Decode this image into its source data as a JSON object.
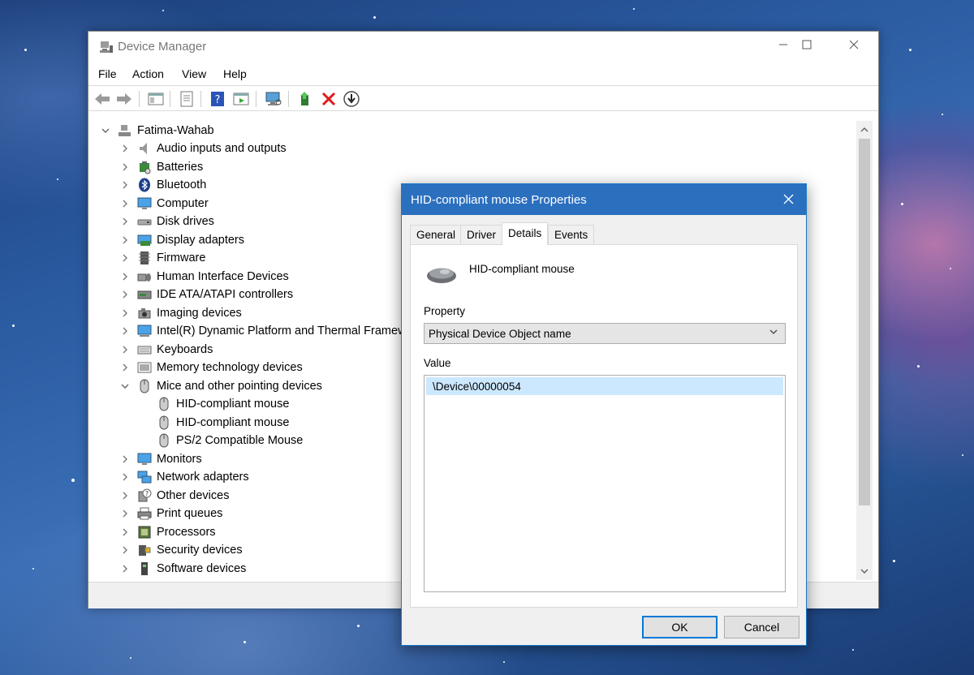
{
  "device_manager": {
    "title": "Device Manager",
    "menu": [
      "File",
      "Action",
      "View",
      "Help"
    ],
    "toolbar": [
      "back-icon",
      "forward-icon",
      "properties-pane-icon",
      "properties-icon",
      "help-icon",
      "details-view-icon",
      "scan-hardware-icon",
      "update-driver-icon",
      "uninstall-icon",
      "disable-icon"
    ],
    "tree": {
      "root": "Fatima-Wahab",
      "items": [
        {
          "label": "Audio inputs and outputs",
          "icon": "speaker-icon",
          "expanded": false
        },
        {
          "label": "Batteries",
          "icon": "battery-icon",
          "expanded": false
        },
        {
          "label": "Bluetooth",
          "icon": "bluetooth-icon",
          "expanded": false
        },
        {
          "label": "Computer",
          "icon": "computer-icon",
          "expanded": false
        },
        {
          "label": "Disk drives",
          "icon": "disk-icon",
          "expanded": false
        },
        {
          "label": "Display adapters",
          "icon": "display-adapter-icon",
          "expanded": false
        },
        {
          "label": "Firmware",
          "icon": "chip-icon",
          "expanded": false
        },
        {
          "label": "Human Interface Devices",
          "icon": "hid-icon",
          "expanded": false
        },
        {
          "label": "IDE ATA/ATAPI controllers",
          "icon": "ide-icon",
          "expanded": false
        },
        {
          "label": "Imaging devices",
          "icon": "camera-icon",
          "expanded": false
        },
        {
          "label": "Intel(R) Dynamic Platform and Thermal Framework",
          "icon": "platform-icon",
          "expanded": false
        },
        {
          "label": "Keyboards",
          "icon": "keyboard-icon",
          "expanded": false
        },
        {
          "label": "Memory technology devices",
          "icon": "memory-icon",
          "expanded": false
        },
        {
          "label": "Mice and other pointing devices",
          "icon": "mouse-icon",
          "expanded": true,
          "children": [
            "HID-compliant mouse",
            "HID-compliant mouse",
            "PS/2 Compatible Mouse"
          ]
        },
        {
          "label": "Monitors",
          "icon": "monitor-icon",
          "expanded": false
        },
        {
          "label": "Network adapters",
          "icon": "network-icon",
          "expanded": false
        },
        {
          "label": "Other devices",
          "icon": "unknown-device-icon",
          "expanded": false
        },
        {
          "label": "Print queues",
          "icon": "printer-icon",
          "expanded": false
        },
        {
          "label": "Processors",
          "icon": "processor-icon",
          "expanded": false
        },
        {
          "label": "Security devices",
          "icon": "security-icon",
          "expanded": false
        },
        {
          "label": "Software devices",
          "icon": "software-icon",
          "expanded": false
        }
      ]
    }
  },
  "dialog": {
    "title": "HID-compliant mouse Properties",
    "tabs": [
      "General",
      "Driver",
      "Details",
      "Events"
    ],
    "active_tab": "Details",
    "device_name": "HID-compliant mouse",
    "property_label": "Property",
    "property_value": "Physical Device Object name",
    "value_label": "Value",
    "value_items": [
      "\\Device\\00000054"
    ],
    "ok_label": "OK",
    "cancel_label": "Cancel"
  },
  "colors": {
    "dialog_title_bg": "#2b6fbf",
    "selection": "#cce8ff",
    "default_button_border": "#0078d7"
  }
}
